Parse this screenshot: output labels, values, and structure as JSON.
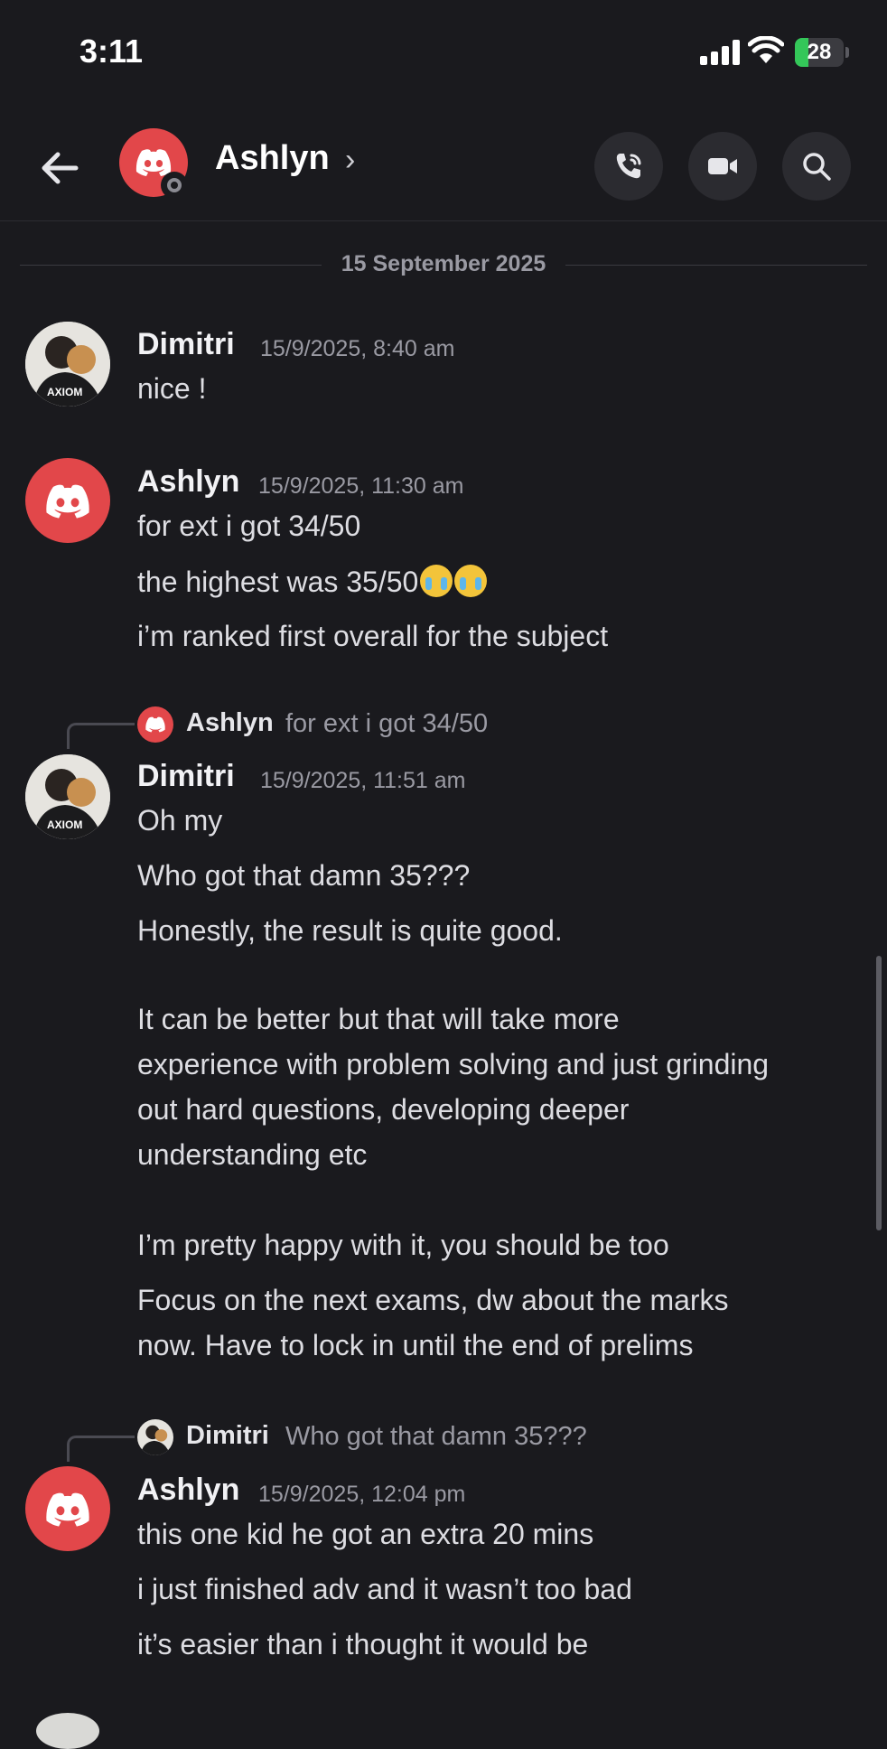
{
  "status_bar": {
    "time": "3:11",
    "battery": "28"
  },
  "header": {
    "contact_name": "Ashlyn",
    "chevron": "›",
    "icons": [
      "back-arrow-icon",
      "phone-call-icon",
      "video-camera-icon",
      "search-icon"
    ]
  },
  "date_divider": "15 September 2025",
  "messages": [
    {
      "author": "Dimitri",
      "timestamp": "15/9/2025, 8:40 am",
      "lines": [
        "nice !"
      ]
    },
    {
      "author": "Ashlyn",
      "timestamp": "15/9/2025, 11:30 am",
      "lines": [
        "for ext i got 34/50",
        "the highest was 35/50",
        "i’m ranked first overall for the subject"
      ]
    },
    {
      "reply_to": {
        "author": "Ashlyn",
        "text": "for ext i got 34/50"
      },
      "author": "Dimitri",
      "timestamp": "15/9/2025, 11:51 am",
      "lines": [
        "Oh my",
        "Who got that damn 35???",
        "Honestly, the result is quite good.",
        "It can be better but that will take more",
        "experience with problem solving and just grinding",
        "out hard questions, developing deeper",
        "understanding etc",
        "I’m pretty happy with it, you should be too",
        "Focus on the next exams, dw about the marks",
        "now. Have to lock in until the end of prelims"
      ]
    },
    {
      "reply_to": {
        "author": "Dimitri",
        "text": "Who got that damn 35???"
      },
      "author": "Ashlyn",
      "timestamp": "15/9/2025, 12:04 pm",
      "lines": [
        "this one kid he got an extra 20 mins",
        "i just finished adv and it wasn’t too bad",
        "it’s easier than i thought it would be"
      ]
    }
  ],
  "colors": {
    "background": "#1a1a1e",
    "discord_red": "#e2474a",
    "muted_text": "#9a9aa3"
  }
}
